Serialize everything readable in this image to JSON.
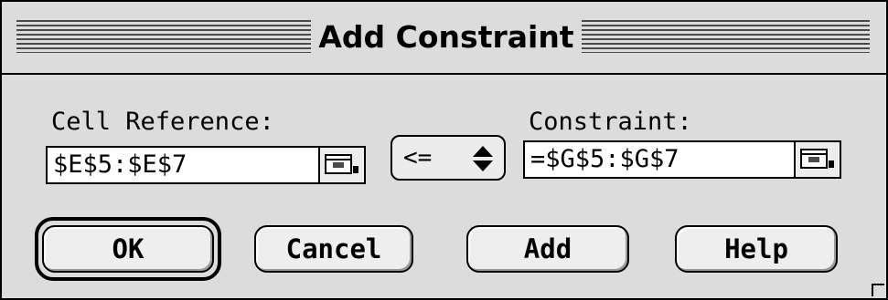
{
  "dialog": {
    "title": "Add Constraint"
  },
  "cell_reference": {
    "label": "Cell Reference:",
    "value": "$E$5:$E$7",
    "collapse_icon": "range-collapse-icon"
  },
  "operator": {
    "selected": "<=",
    "icon": "up-down-arrows-icon"
  },
  "constraint": {
    "label": "Constraint:",
    "value": "=$G$5:$G$7",
    "collapse_icon": "range-collapse-icon"
  },
  "buttons": {
    "ok": "OK",
    "cancel": "Cancel",
    "add": "Add",
    "help": "Help"
  }
}
